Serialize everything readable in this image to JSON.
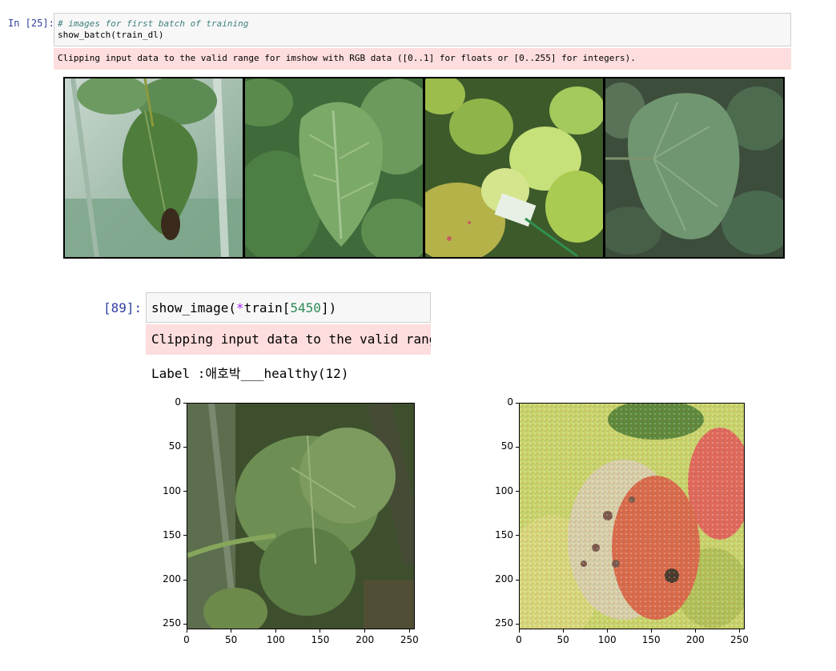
{
  "cell1": {
    "prompt": "In [25]:",
    "code_comment": "# images for first batch of training",
    "code": "show_batch(train_dl)",
    "stderr": "Clipping input data to the valid range for imshow with RGB data ([0..1] for floats or [0..255] for integers).",
    "images": [
      {
        "icon": "vine-leaf-greenhouse-image"
      },
      {
        "icon": "green-leaves-closeup-image"
      },
      {
        "icon": "leaves-with-plant-tag-image"
      },
      {
        "icon": "large-round-leaf-image"
      }
    ]
  },
  "cell2": {
    "prompt": "[89]:",
    "code_fn": "show_image(",
    "code_op": "*",
    "code_arg": "train[",
    "code_num": "5450",
    "code_end": "])",
    "stderr": "Clipping input data to the valid rang",
    "label_text": "Label :애호박___healthy(12)",
    "plots": [
      {
        "x_ticks": [
          "0",
          "50",
          "100",
          "150",
          "200",
          "250"
        ],
        "y_ticks": [
          "0",
          "50",
          "100",
          "150",
          "200",
          "250"
        ],
        "icon": "pumpkin-leaf-plot-image"
      },
      {
        "x_ticks": [
          "0",
          "50",
          "100",
          "150",
          "200",
          "250"
        ],
        "y_ticks": [
          "0",
          "50",
          "100",
          "150",
          "200",
          "250"
        ],
        "icon": "noisy-pumpkin-fruit-plot-image"
      }
    ]
  },
  "colors": {
    "prompt": "#303f9f",
    "stderr_bg": "#fddddd",
    "code_bg": "#f7f7f7"
  }
}
